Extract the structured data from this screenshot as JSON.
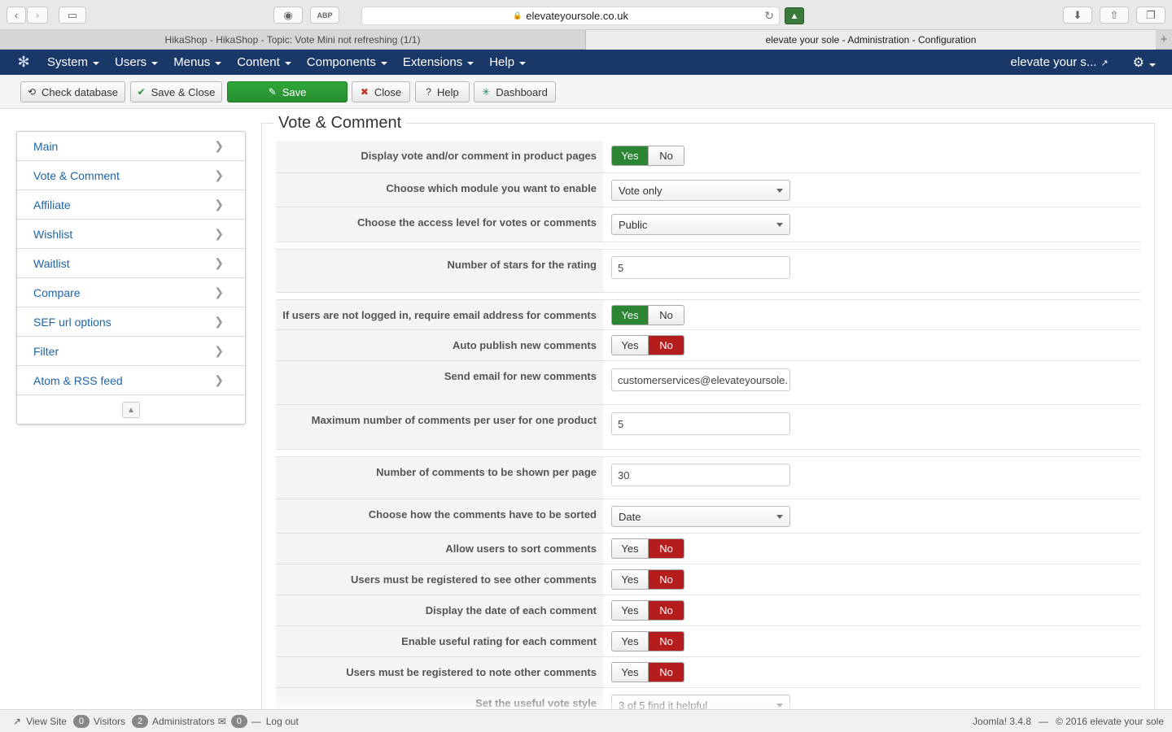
{
  "browser": {
    "url": "elevateyoursole.co.uk",
    "tabs": [
      {
        "title": "HikaShop - HikaShop - Topic: Vote Mini not refreshing (1/1)"
      },
      {
        "title": "elevate your sole - Administration - Configuration"
      }
    ]
  },
  "navbar": {
    "menu": [
      "System",
      "Users",
      "Menus",
      "Content",
      "Components",
      "Extensions",
      "Help"
    ],
    "site_name": "elevate your s..."
  },
  "toolbar": {
    "check_database": "Check database",
    "save_close": "Save & Close",
    "save": "Save",
    "close": "Close",
    "help": "Help",
    "dashboard": "Dashboard"
  },
  "sidebar": {
    "items": [
      {
        "label": "Main"
      },
      {
        "label": "Vote & Comment"
      },
      {
        "label": "Affiliate"
      },
      {
        "label": "Wishlist"
      },
      {
        "label": "Waitlist"
      },
      {
        "label": "Compare"
      },
      {
        "label": "SEF url options"
      },
      {
        "label": "Filter"
      },
      {
        "label": "Atom & RSS feed"
      }
    ]
  },
  "section": {
    "title": "Vote & Comment"
  },
  "fields": {
    "display_vote": {
      "label": "Display vote and/or comment in product pages",
      "yes": "Yes",
      "no": "No",
      "value": "Yes"
    },
    "module": {
      "label": "Choose which module you want to enable",
      "value": "Vote only"
    },
    "access": {
      "label": "Choose the access level for votes or comments",
      "value": "Public"
    },
    "stars": {
      "label": "Number of stars for the rating",
      "value": "5"
    },
    "require_email": {
      "label": "If users are not logged in, require email address for comments",
      "yes": "Yes",
      "no": "No",
      "value": "Yes"
    },
    "auto_publish": {
      "label": "Auto publish new comments",
      "yes": "Yes",
      "no": "No",
      "value": "No"
    },
    "send_email": {
      "label": "Send email for new comments",
      "value": "customerservices@elevateyoursole."
    },
    "max_comments": {
      "label": "Maximum number of comments per user for one product",
      "value": "5"
    },
    "per_page": {
      "label": "Number of comments to be shown per page",
      "value": "30"
    },
    "sort_by": {
      "label": "Choose how the comments have to be sorted",
      "value": "Date"
    },
    "allow_sort": {
      "label": "Allow users to sort comments",
      "yes": "Yes",
      "no": "No",
      "value": "No"
    },
    "reg_see": {
      "label": "Users must be registered to see other comments",
      "yes": "Yes",
      "no": "No",
      "value": "No"
    },
    "show_date": {
      "label": "Display the date of each comment",
      "yes": "Yes",
      "no": "No",
      "value": "No"
    },
    "useful_rating": {
      "label": "Enable useful rating for each comment",
      "yes": "Yes",
      "no": "No",
      "value": "No"
    },
    "reg_note": {
      "label": "Users must be registered to note other comments",
      "yes": "Yes",
      "no": "No",
      "value": "No"
    },
    "vote_style": {
      "label": "Set the useful vote style",
      "value": "3 of 5 find it helpful"
    }
  },
  "footer": {
    "view_site": "View Site",
    "visitors_count": "0",
    "visitors_label": "Visitors",
    "admins_count": "2",
    "admins_label": "Administrators",
    "messages_count": "0",
    "logout": "Log out",
    "version": "Joomla! 3.4.8",
    "separator": "—",
    "copyright": "© 2016 elevate your sole"
  }
}
